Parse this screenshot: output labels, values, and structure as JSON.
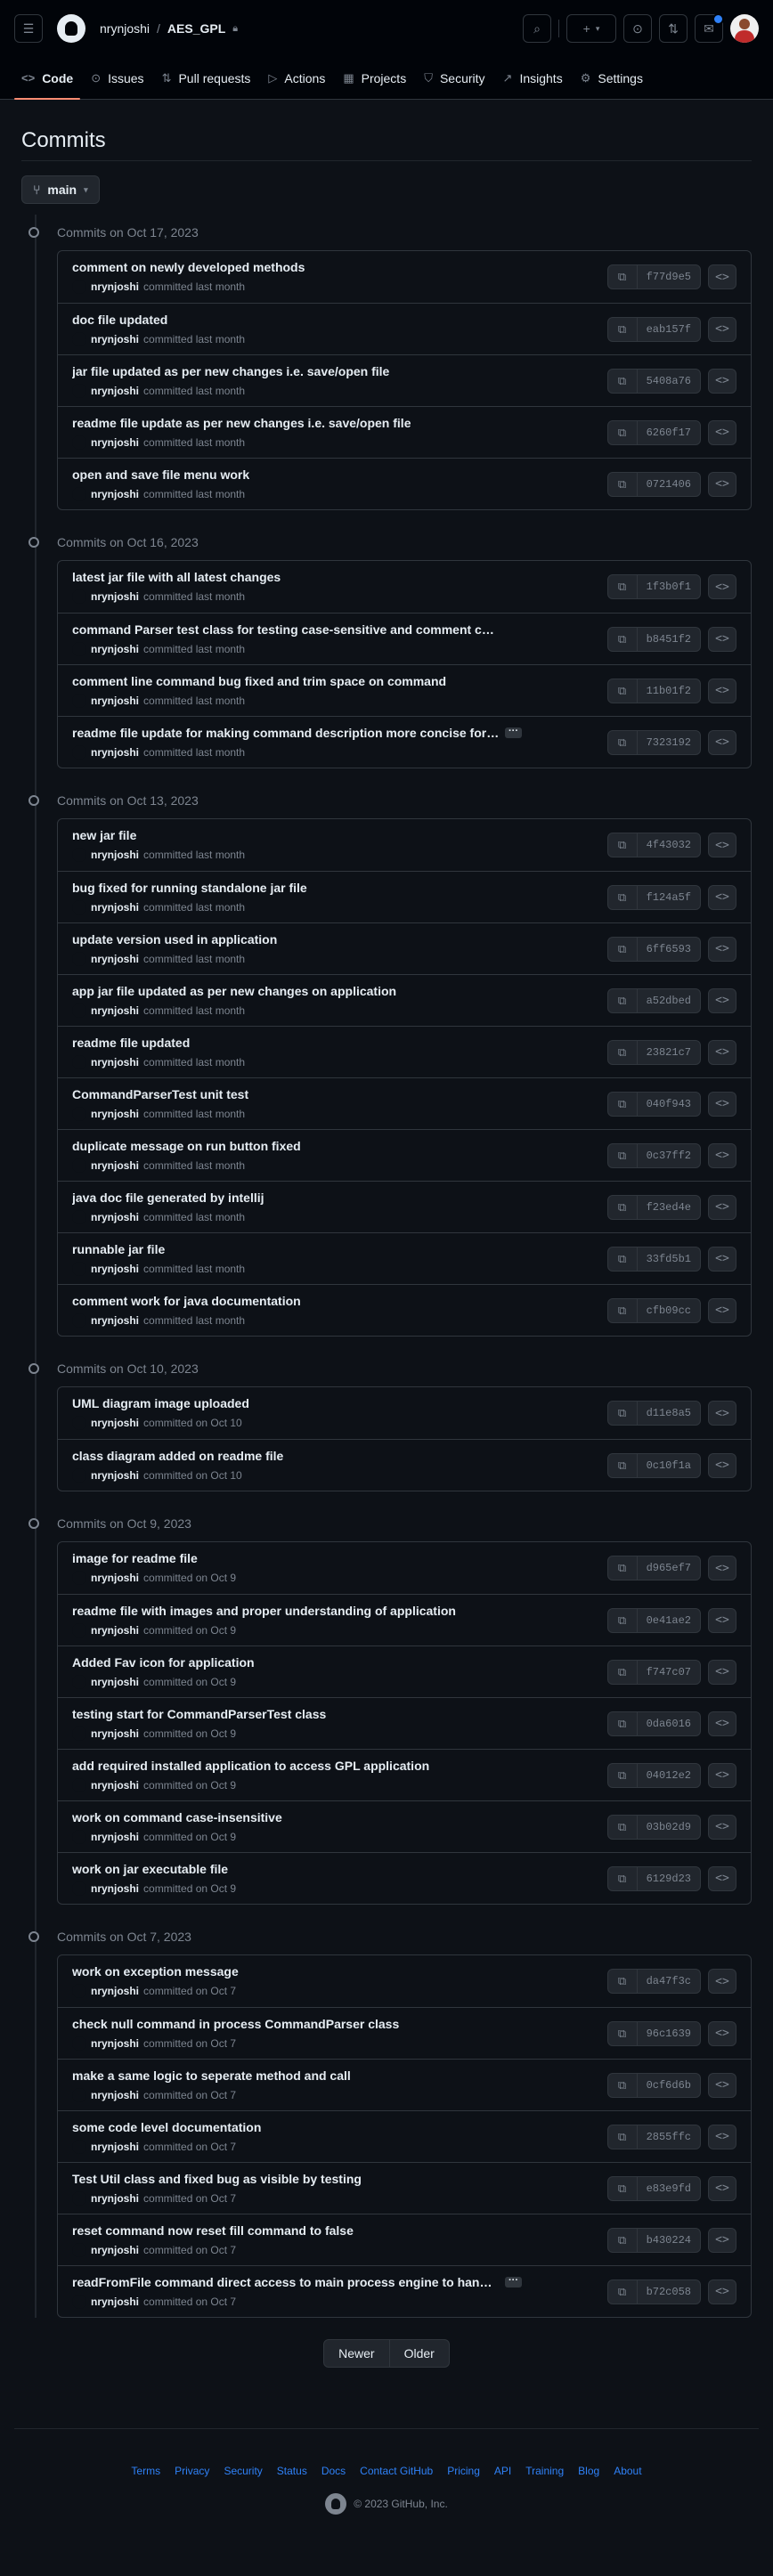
{
  "header": {
    "owner": "nrynjoshi",
    "separator": "/",
    "repo": "AES_GPL"
  },
  "tabs": [
    {
      "label": "Code",
      "icon": "code-icon",
      "active": true
    },
    {
      "label": "Issues",
      "icon": "issue-opened-icon"
    },
    {
      "label": "Pull requests",
      "icon": "git-pull-request-icon"
    },
    {
      "label": "Actions",
      "icon": "play-icon"
    },
    {
      "label": "Projects",
      "icon": "table-icon"
    },
    {
      "label": "Security",
      "icon": "shield-icon"
    },
    {
      "label": "Insights",
      "icon": "graph-icon"
    },
    {
      "label": "Settings",
      "icon": "gear-icon"
    }
  ],
  "page": {
    "title": "Commits",
    "branch": "main"
  },
  "groups": [
    {
      "date": "Commits on Oct 17, 2023",
      "commits": [
        {
          "message": "comment on newly developed methods",
          "author": "nrynjoshi",
          "time": "committed last month",
          "sha": "f77d9e5"
        },
        {
          "message": "doc file updated",
          "author": "nrynjoshi",
          "time": "committed last month",
          "sha": "eab157f"
        },
        {
          "message": "jar file updated as per new changes i.e. save/open file",
          "author": "nrynjoshi",
          "time": "committed last month",
          "sha": "5408a76"
        },
        {
          "message": "readme file update as per new changes i.e. save/open file",
          "author": "nrynjoshi",
          "time": "committed last month",
          "sha": "6260f17"
        },
        {
          "message": "open and save file menu work",
          "author": "nrynjoshi",
          "time": "committed last month",
          "sha": "0721406"
        }
      ]
    },
    {
      "date": "Commits on Oct 16, 2023",
      "commits": [
        {
          "message": "latest jar file with all latest changes",
          "author": "nrynjoshi",
          "time": "committed last month",
          "sha": "1f3b0f1"
        },
        {
          "message": "command Parser test class for testing case-sensitive and comment cmd.",
          "author": "nrynjoshi",
          "time": "committed last month",
          "sha": "b8451f2"
        },
        {
          "message": "comment line command bug fixed and trim space on command",
          "author": "nrynjoshi",
          "time": "committed last month",
          "sha": "11b01f2"
        },
        {
          "message": "readme file update for making command description more concise for co…",
          "author": "nrynjoshi",
          "time": "committed last month",
          "sha": "7323192",
          "truncated": true
        }
      ]
    },
    {
      "date": "Commits on Oct 13, 2023",
      "commits": [
        {
          "message": "new jar file",
          "author": "nrynjoshi",
          "time": "committed last month",
          "sha": "4f43032"
        },
        {
          "message": "bug fixed for running standalone jar file",
          "author": "nrynjoshi",
          "time": "committed last month",
          "sha": "f124a5f"
        },
        {
          "message": "update version used in application",
          "author": "nrynjoshi",
          "time": "committed last month",
          "sha": "6ff6593"
        },
        {
          "message": "app jar file updated as per new changes on application",
          "author": "nrynjoshi",
          "time": "committed last month",
          "sha": "a52dbed"
        },
        {
          "message": "readme file updated",
          "author": "nrynjoshi",
          "time": "committed last month",
          "sha": "23821c7"
        },
        {
          "message": "CommandParserTest unit test",
          "author": "nrynjoshi",
          "time": "committed last month",
          "sha": "040f943"
        },
        {
          "message": "duplicate message on run button fixed",
          "author": "nrynjoshi",
          "time": "committed last month",
          "sha": "0c37ff2"
        },
        {
          "message": "java doc file generated by intellij",
          "author": "nrynjoshi",
          "time": "committed last month",
          "sha": "f23ed4e"
        },
        {
          "message": "runnable jar file",
          "author": "nrynjoshi",
          "time": "committed last month",
          "sha": "33fd5b1"
        },
        {
          "message": "comment work for java documentation",
          "author": "nrynjoshi",
          "time": "committed last month",
          "sha": "cfb09cc"
        }
      ]
    },
    {
      "date": "Commits on Oct 10, 2023",
      "commits": [
        {
          "message": "UML diagram image uploaded",
          "author": "nrynjoshi",
          "time": "committed on Oct 10",
          "sha": "d11e8a5"
        },
        {
          "message": "class diagram added on readme file",
          "author": "nrynjoshi",
          "time": "committed on Oct 10",
          "sha": "0c10f1a"
        }
      ]
    },
    {
      "date": "Commits on Oct 9, 2023",
      "commits": [
        {
          "message": "image for readme file",
          "author": "nrynjoshi",
          "time": "committed on Oct 9",
          "sha": "d965ef7"
        },
        {
          "message": "readme file with images and proper understanding of application",
          "author": "nrynjoshi",
          "time": "committed on Oct 9",
          "sha": "0e41ae2"
        },
        {
          "message": "Added Fav icon for application",
          "author": "nrynjoshi",
          "time": "committed on Oct 9",
          "sha": "f747c07"
        },
        {
          "message": "testing start for CommandParserTest class",
          "author": "nrynjoshi",
          "time": "committed on Oct 9",
          "sha": "0da6016"
        },
        {
          "message": "add required installed application to access GPL application",
          "author": "nrynjoshi",
          "time": "committed on Oct 9",
          "sha": "04012e2"
        },
        {
          "message": "work on command case-insensitive",
          "author": "nrynjoshi",
          "time": "committed on Oct 9",
          "sha": "03b02d9"
        },
        {
          "message": "work on jar executable file",
          "author": "nrynjoshi",
          "time": "committed on Oct 9",
          "sha": "6129d23"
        }
      ]
    },
    {
      "date": "Commits on Oct 7, 2023",
      "commits": [
        {
          "message": "work on exception message",
          "author": "nrynjoshi",
          "time": "committed on Oct 7",
          "sha": "da47f3c"
        },
        {
          "message": "check null command in process CommandParser class",
          "author": "nrynjoshi",
          "time": "committed on Oct 7",
          "sha": "96c1639"
        },
        {
          "message": "make a same logic to seperate method and call",
          "author": "nrynjoshi",
          "time": "committed on Oct 7",
          "sha": "0cf6d6b"
        },
        {
          "message": "some code level documentation",
          "author": "nrynjoshi",
          "time": "committed on Oct 7",
          "sha": "2855ffc"
        },
        {
          "message": "Test Util class and fixed bug as visible by testing",
          "author": "nrynjoshi",
          "time": "committed on Oct 7",
          "sha": "e83e9fd"
        },
        {
          "message": "reset command now reset fill command to false",
          "author": "nrynjoshi",
          "time": "committed on Oct 7",
          "sha": "b430224"
        },
        {
          "message": "readFromFile command direct access to main process engine to handle a…",
          "author": "nrynjoshi",
          "time": "committed on Oct 7",
          "sha": "b72c058",
          "truncated": true
        }
      ]
    }
  ],
  "pagination": {
    "newer": "Newer",
    "older": "Older"
  },
  "footer": {
    "links": [
      "Terms",
      "Privacy",
      "Security",
      "Status",
      "Docs",
      "Contact GitHub",
      "Pricing",
      "API",
      "Training",
      "Blog",
      "About"
    ],
    "copyright": "© 2023 GitHub, Inc."
  },
  "colors": {
    "background": "#0d1117",
    "accent_tab": "#fd8c73",
    "link": "#2f81f7"
  }
}
